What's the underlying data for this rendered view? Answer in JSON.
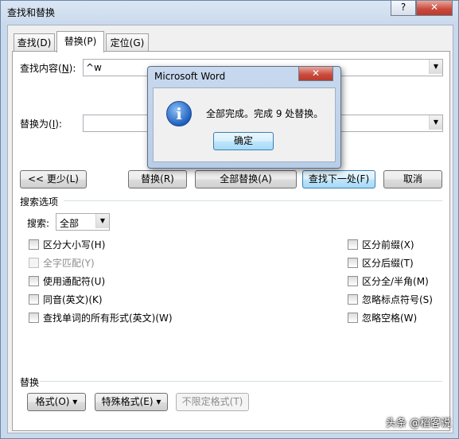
{
  "window": {
    "title": "查找和替换",
    "help_label": "?",
    "close_label": "✕"
  },
  "tabs": [
    {
      "label": "查找",
      "key": "(D)"
    },
    {
      "label": "替换",
      "key": "(P)"
    },
    {
      "label": "定位",
      "key": "(G)"
    }
  ],
  "find": {
    "label": "查找内容(",
    "key": "N",
    "suffix": "):",
    "value": "^w"
  },
  "replace": {
    "label": "替换为(",
    "key": "I",
    "suffix": "):",
    "value": ""
  },
  "buttons": {
    "less": "<< 更少(L)",
    "replace": "替换(R)",
    "replace_all": "全部替换(A)",
    "find_next": "查找下一处(F)",
    "cancel": "取消"
  },
  "search_options": {
    "section_label": "搜索选项",
    "search_label": "搜索:",
    "search_value": "全部"
  },
  "left_options": [
    {
      "label": "区分大小写(H)",
      "checked": false,
      "enabled": true
    },
    {
      "label": "全字匹配(Y)",
      "checked": false,
      "enabled": false
    },
    {
      "label": "使用通配符(U)",
      "checked": false,
      "enabled": true
    },
    {
      "label": "同音(英文)(K)",
      "checked": false,
      "enabled": true
    },
    {
      "label": "查找单词的所有形式(英文)(W)",
      "checked": false,
      "enabled": true
    }
  ],
  "right_options": [
    {
      "label": "区分前缀(X)",
      "checked": false,
      "enabled": true
    },
    {
      "label": "区分后缀(T)",
      "checked": false,
      "enabled": true
    },
    {
      "label": "区分全/半角(M)",
      "checked": false,
      "enabled": true
    },
    {
      "label": "忽略标点符号(S)",
      "checked": false,
      "enabled": true
    },
    {
      "label": "忽略空格(W)",
      "checked": false,
      "enabled": true
    }
  ],
  "replace_section": {
    "label": "替换",
    "format": "格式(O) ▾",
    "special": "特殊格式(E) ▾",
    "no_format": "不限定格式(T)"
  },
  "message_box": {
    "title": "Microsoft Word",
    "message": "全部完成。完成 9 处替换。",
    "ok": "确定",
    "close_label": "✕",
    "icon": "info-icon"
  },
  "watermark": "头条 @稻客说"
}
